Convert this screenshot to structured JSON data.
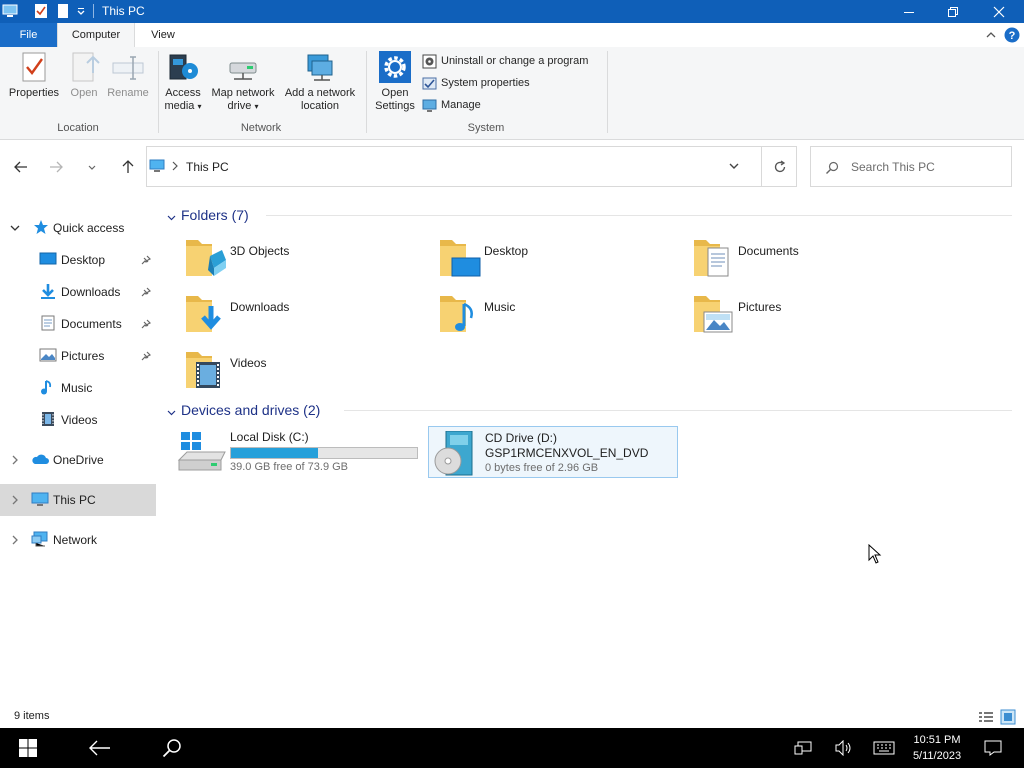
{
  "window": {
    "title": "This PC"
  },
  "ribbon_tabs": {
    "file": "File",
    "computer": "Computer",
    "view": "View"
  },
  "ribbon": {
    "location": {
      "properties": "Properties",
      "open": "Open",
      "rename": "Rename",
      "group": "Location"
    },
    "network": {
      "access_media_1": "Access",
      "access_media_2": "media",
      "map_drive_1": "Map network",
      "map_drive_2": "drive",
      "add_location_1": "Add a network",
      "add_location_2": "location",
      "group": "Network"
    },
    "system": {
      "open_settings_1": "Open",
      "open_settings_2": "Settings",
      "uninstall": "Uninstall or change a program",
      "system_properties": "System properties",
      "manage": "Manage",
      "group": "System"
    }
  },
  "address": {
    "crumb": "This PC",
    "search_placeholder": "Search This PC"
  },
  "nav": {
    "quick_access": "Quick access",
    "items": [
      "Desktop",
      "Downloads",
      "Documents",
      "Pictures",
      "Music",
      "Videos"
    ],
    "onedrive": "OneDrive",
    "this_pc": "This PC",
    "network": "Network"
  },
  "content": {
    "folders_header": "Folders (7)",
    "folders": [
      "3D Objects",
      "Desktop",
      "Documents",
      "Downloads",
      "Music",
      "Pictures",
      "Videos"
    ],
    "drives_header": "Devices and drives (2)",
    "drives": [
      {
        "name": "Local Disk (C:)",
        "free": "39.0 GB free of 73.9 GB",
        "used_fraction": 0.47
      },
      {
        "name": "CD Drive (D:)",
        "label": "GSP1RMCENXVOL_EN_DVD",
        "free": "0 bytes free of 2.96 GB"
      }
    ]
  },
  "status": {
    "count": "9 items"
  },
  "taskbar": {
    "time": "10:51 PM",
    "date": "5/11/2023"
  },
  "colors": {
    "titlebar": "#0f5fb8",
    "accent": "#1a6dc8",
    "selection": "#d9d9d9",
    "drive_fill": "#26a0da"
  }
}
